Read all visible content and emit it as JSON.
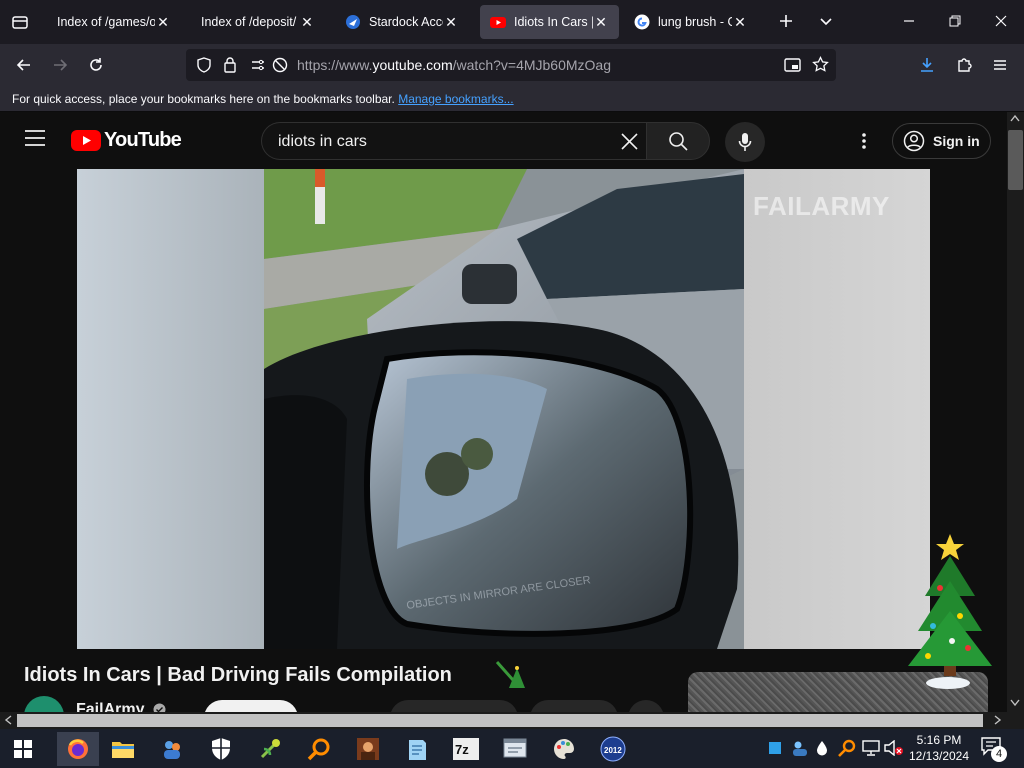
{
  "browser": {
    "tabs": [
      {
        "label": "Index of /games/oth",
        "active": false
      },
      {
        "label": "Index of /deposit/",
        "active": false
      },
      {
        "label": "Stardock Accou",
        "active": false
      },
      {
        "label": "Idiots In Cars | B",
        "active": true
      },
      {
        "label": "lung brush - Go",
        "active": false
      }
    ],
    "url_prefix": "https://www.",
    "url_domain": "youtube.com",
    "url_path": "/watch?v=4MJb60MzOag",
    "bookmarks_message": "For quick access, place your bookmarks here on the bookmarks toolbar.",
    "bookmarks_link": "Manage bookmarks..."
  },
  "youtube": {
    "logo_text": "YouTube",
    "search_query": "idiots in cars",
    "sign_in_label": "Sign in",
    "video_watermark": "FAILARMY",
    "mirror_caption": "OBJECTS IN MIRROR ARE CLOSER",
    "video_title": "Idiots In Cars | Bad Driving Fails Compilation",
    "channel_name": "FailArmy"
  },
  "taskbar": {
    "time": "5:16 PM",
    "date": "12/13/2024",
    "notification_count": "4",
    "tray_badge": "2012"
  },
  "colors": {
    "youtube_red": "#ff0000",
    "link_blue": "#45a1ff",
    "tab_active": "#42414d",
    "taskbar_bg": "#1a1f2b"
  }
}
